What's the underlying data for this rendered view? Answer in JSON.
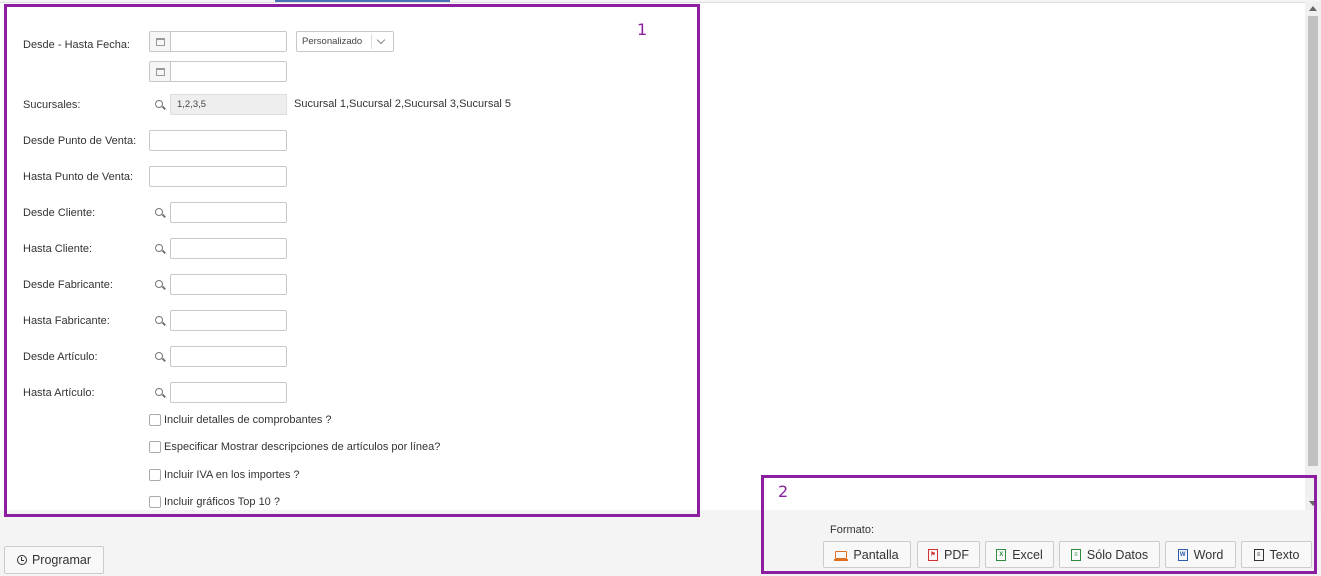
{
  "annotations": {
    "box1_label": "1",
    "box2_label": "2",
    "color": "#8b1fa0"
  },
  "form": {
    "fecha_label": "Desde - Hasta Fecha:",
    "fecha_desde_value": "",
    "fecha_hasta_value": "",
    "rango_select": "Personalizado",
    "sucursales_label": "Sucursales:",
    "sucursales_value": "1,2,3,5",
    "sucursales_names": "Sucursal 1,Sucursal 2,Sucursal 3,Sucursal 5",
    "desde_pv_label": "Desde Punto de Venta:",
    "hasta_pv_label": "Hasta Punto de Venta:",
    "desde_cliente_label": "Desde Cliente:",
    "hasta_cliente_label": "Hasta Cliente:",
    "desde_fabricante_label": "Desde Fabricante:",
    "hasta_fabricante_label": "Hasta Fabricante:",
    "desde_articulo_label": "Desde Artículo:",
    "hasta_articulo_label": "Hasta Artículo:",
    "checks": [
      {
        "label": "Incluir detalles de comprobantes ?",
        "checked": false
      },
      {
        "label": "Especificar Mostrar descripciones de artículos por línea?",
        "checked": false
      },
      {
        "label": "Incluir IVA en los importes ?",
        "checked": false
      },
      {
        "label": "Incluir gráficos Top 10 ?",
        "checked": false
      }
    ]
  },
  "footer": {
    "programar_label": "Programar",
    "formato_label": "Formato:",
    "buttons": [
      {
        "label": "Pantalla",
        "icon": "screen-icon",
        "color": "#e07020"
      },
      {
        "label": "PDF",
        "icon": "pdf-icon",
        "color": "#d03030"
      },
      {
        "label": "Excel",
        "icon": "excel-icon",
        "color": "#2e8b3e"
      },
      {
        "label": "Sólo Datos",
        "icon": "data-file-icon",
        "color": "#2e8b3e"
      },
      {
        "label": "Word",
        "icon": "word-icon",
        "color": "#2b5cb0"
      },
      {
        "label": "Texto",
        "icon": "text-file-icon",
        "color": "#333333"
      }
    ]
  }
}
